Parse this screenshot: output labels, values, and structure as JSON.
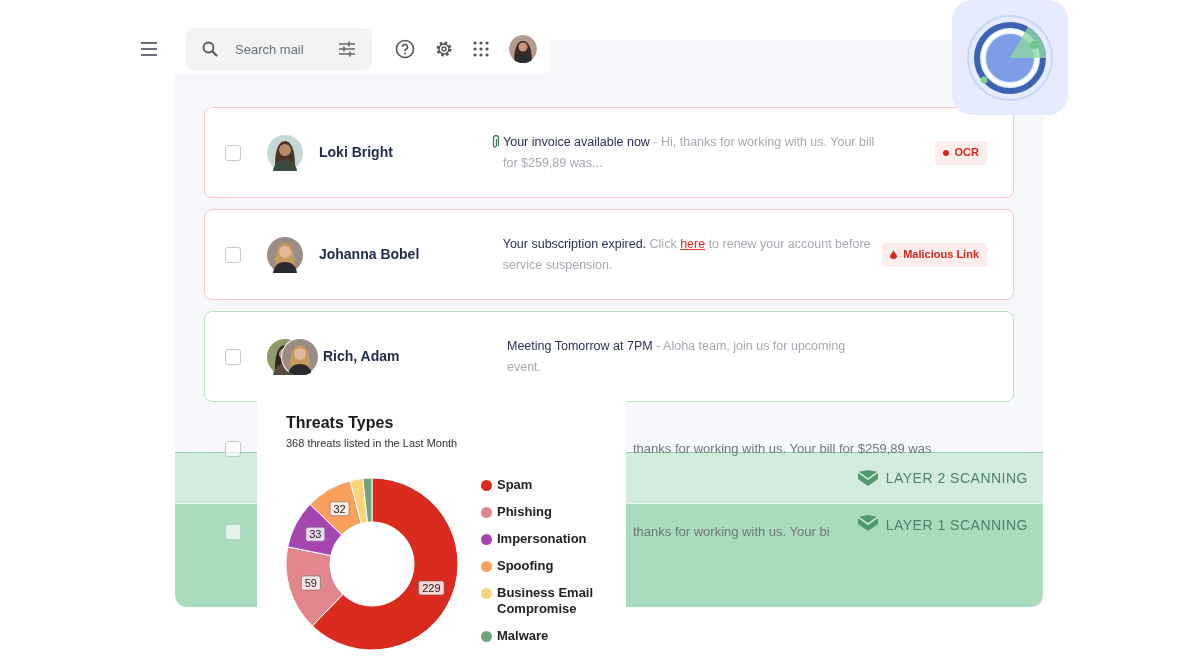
{
  "search": {
    "placeholder": "Search mail"
  },
  "emails": [
    {
      "sender": "Loki Bright",
      "color": "#f7c9c9",
      "checked": false,
      "attachment": true,
      "subject": "Your invoice available now",
      "preview": "- Hi, thanks for working with us. Your bill for $259,89 was...",
      "badge": {
        "label": "OCR",
        "kind": "dot"
      }
    },
    {
      "sender": "Johanna Bobel",
      "color": "#f7c9c9",
      "checked": false,
      "attachment": false,
      "subject": "Your subscription expired.",
      "preview": "Click",
      "link": "here",
      "preview_after": "to renew your account before service suspension.",
      "badge": {
        "label": "Malicious Link",
        "kind": "drop"
      }
    },
    {
      "sender": "Rich, Adam",
      "color": "#b7e4c4",
      "checked": false,
      "attachment": false,
      "subject": "Meeting Tomorrow at 7PM",
      "preview": "- Aloha team, join us for upcoming event."
    },
    {
      "checked": false,
      "preview": "thanks for working with us. Your bill for $259,89 was"
    },
    {
      "checked": false,
      "preview": "thanks for working with us. Your bi"
    }
  ],
  "layers": [
    {
      "label": "LAYER 2 SCANNING"
    },
    {
      "label": "LAYER 1 SCANNING"
    }
  ],
  "card": {
    "title": "Threats Types",
    "subtitle": "368 threats listed in the Last Month",
    "chart_data": {
      "type": "donut",
      "categories": [
        "Spam",
        "Phishing",
        "Impersonation",
        "Spoofing",
        "Business Email Compromise",
        "Malware"
      ],
      "series": [
        {
          "values": [
            62.2,
            16.0,
            9.0,
            8.7,
            2.4,
            1.7
          ]
        }
      ],
      "colors": [
        "#d92b1e",
        "#e0868c",
        "#a746b0",
        "#fb9f5c",
        "#f9d47a",
        "#6fa57c"
      ],
      "value_labels": [
        "229",
        "59",
        "33",
        "32",
        null,
        null
      ]
    }
  }
}
